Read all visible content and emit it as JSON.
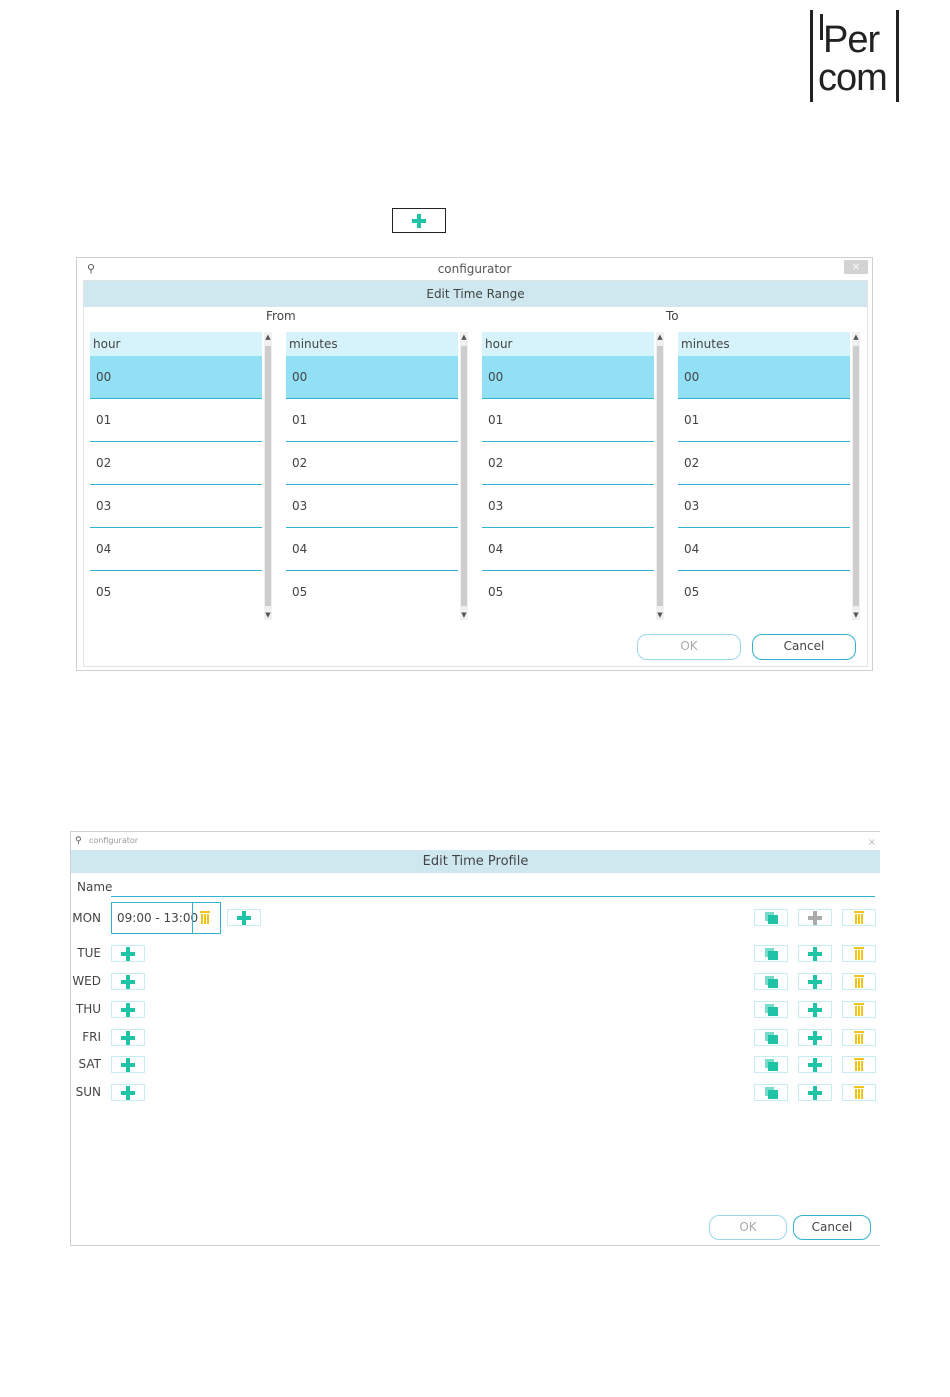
{
  "logo": {
    "line1": "Per",
    "line2": "com"
  },
  "window1": {
    "title": "configurator",
    "close": "×",
    "dialog_title": "Edit Time Range",
    "from_label": "From",
    "to_label": "To",
    "columns": [
      {
        "header": "hour",
        "rows": [
          "00",
          "01",
          "02",
          "03",
          "04",
          "05"
        ]
      },
      {
        "header": "minutes",
        "rows": [
          "00",
          "01",
          "02",
          "03",
          "04",
          "05"
        ]
      },
      {
        "header": "hour",
        "rows": [
          "00",
          "01",
          "02",
          "03",
          "04",
          "05"
        ]
      },
      {
        "header": "minutes",
        "rows": [
          "00",
          "01",
          "02",
          "03",
          "04",
          "05"
        ]
      }
    ],
    "ok_label": "OK",
    "cancel_label": "Cancel"
  },
  "window2": {
    "title": "configurator",
    "close": "×",
    "dialog_title": "Edit Time Profile",
    "name_label": "Name",
    "days": [
      "MON",
      "TUE",
      "WED",
      "THU",
      "FRI",
      "SAT",
      "SUN"
    ],
    "mon_range": "09:00 - 13:00",
    "ok_label": "OK",
    "cancel_label": "Cancel"
  },
  "colors": {
    "accent": "#1fc4a7",
    "border": "#2fb3cf",
    "selected_row": "#92e0f5",
    "trash": "#f0c419"
  }
}
